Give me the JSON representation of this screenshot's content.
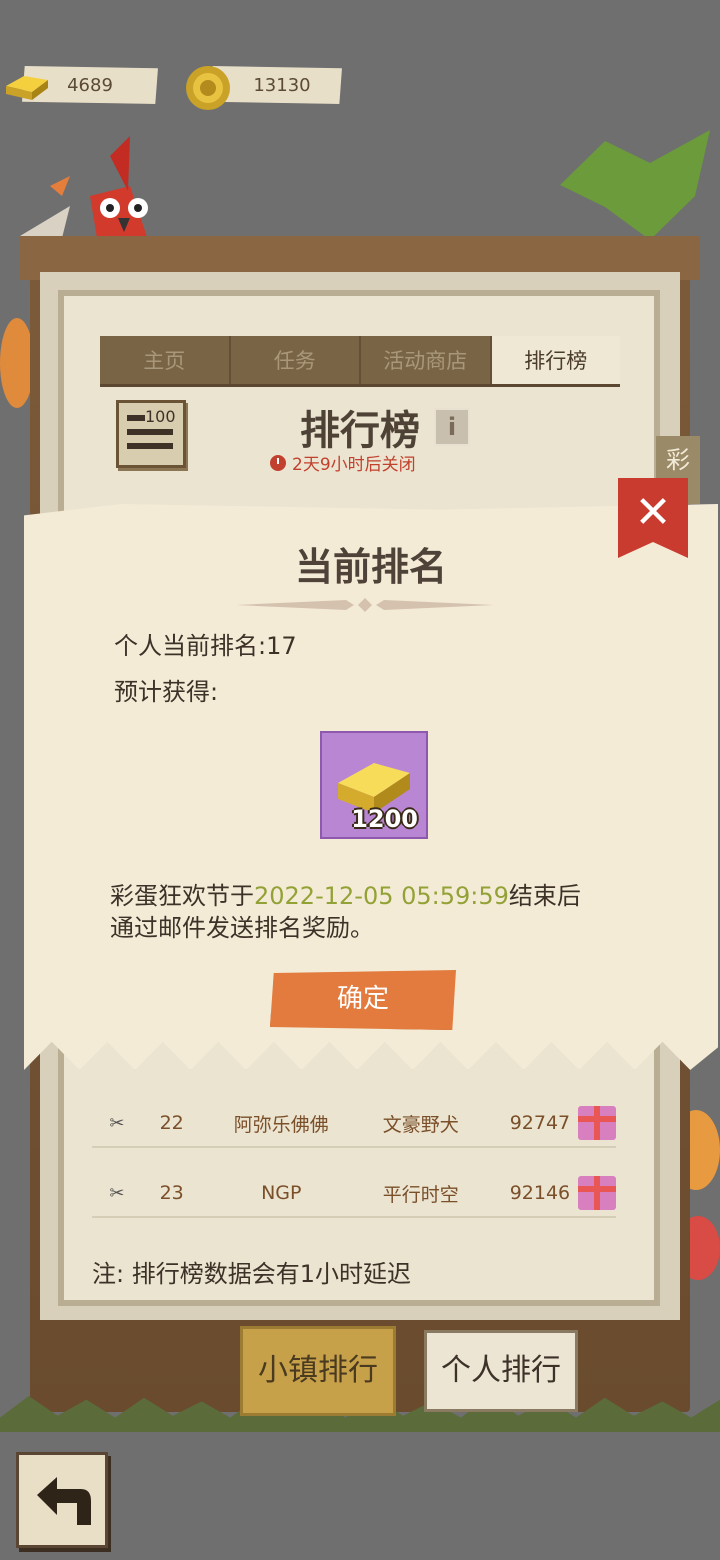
{
  "currency": {
    "gold_bars": "4689",
    "coins": "13130"
  },
  "tabs": [
    {
      "label": "主页",
      "active": false
    },
    {
      "label": "任务",
      "active": false
    },
    {
      "label": "活动商店",
      "active": false
    },
    {
      "label": "排行榜",
      "active": true
    }
  ],
  "header": {
    "rank_icon_text": "100",
    "title": "排行榜",
    "info_label": "i",
    "timer": "2天9小时后关闭",
    "side_tag": "彩"
  },
  "dialog": {
    "title": "当前排名",
    "close_label": "✕",
    "current_rank_label": "个人当前排名:17",
    "expected_label": "预计获得:",
    "reward_amount": "1200",
    "notice_prefix": "彩蛋狂欢节于",
    "notice_date": "2022-12-05 05:59:59",
    "notice_suffix": "结束后",
    "notice_line2": "通过邮件发送排名奖励。",
    "confirm_label": "确定"
  },
  "leaderboard": {
    "rows": [
      {
        "rank": "22",
        "name": "阿弥乐佛佛",
        "town": "文豪野犬",
        "score": "92747"
      },
      {
        "rank": "23",
        "name": "NGP",
        "town": "平行时空",
        "score": "92146"
      }
    ],
    "note": "注: 排行榜数据会有1小时延迟"
  },
  "bottom_tabs": {
    "town_label": "小镇排行",
    "personal_label": "个人排行"
  },
  "icons": [
    "gold-bar-icon",
    "coin-icon",
    "leaderboard-icon",
    "info-icon",
    "clock-icon",
    "close-icon",
    "gift-icon",
    "scissors-icon",
    "back-arrow-icon"
  ],
  "colors": {
    "accent_orange": "#e27b3d",
    "close_red": "#c93a2f",
    "date_green": "#93a236",
    "timer_red": "#c2402e"
  }
}
